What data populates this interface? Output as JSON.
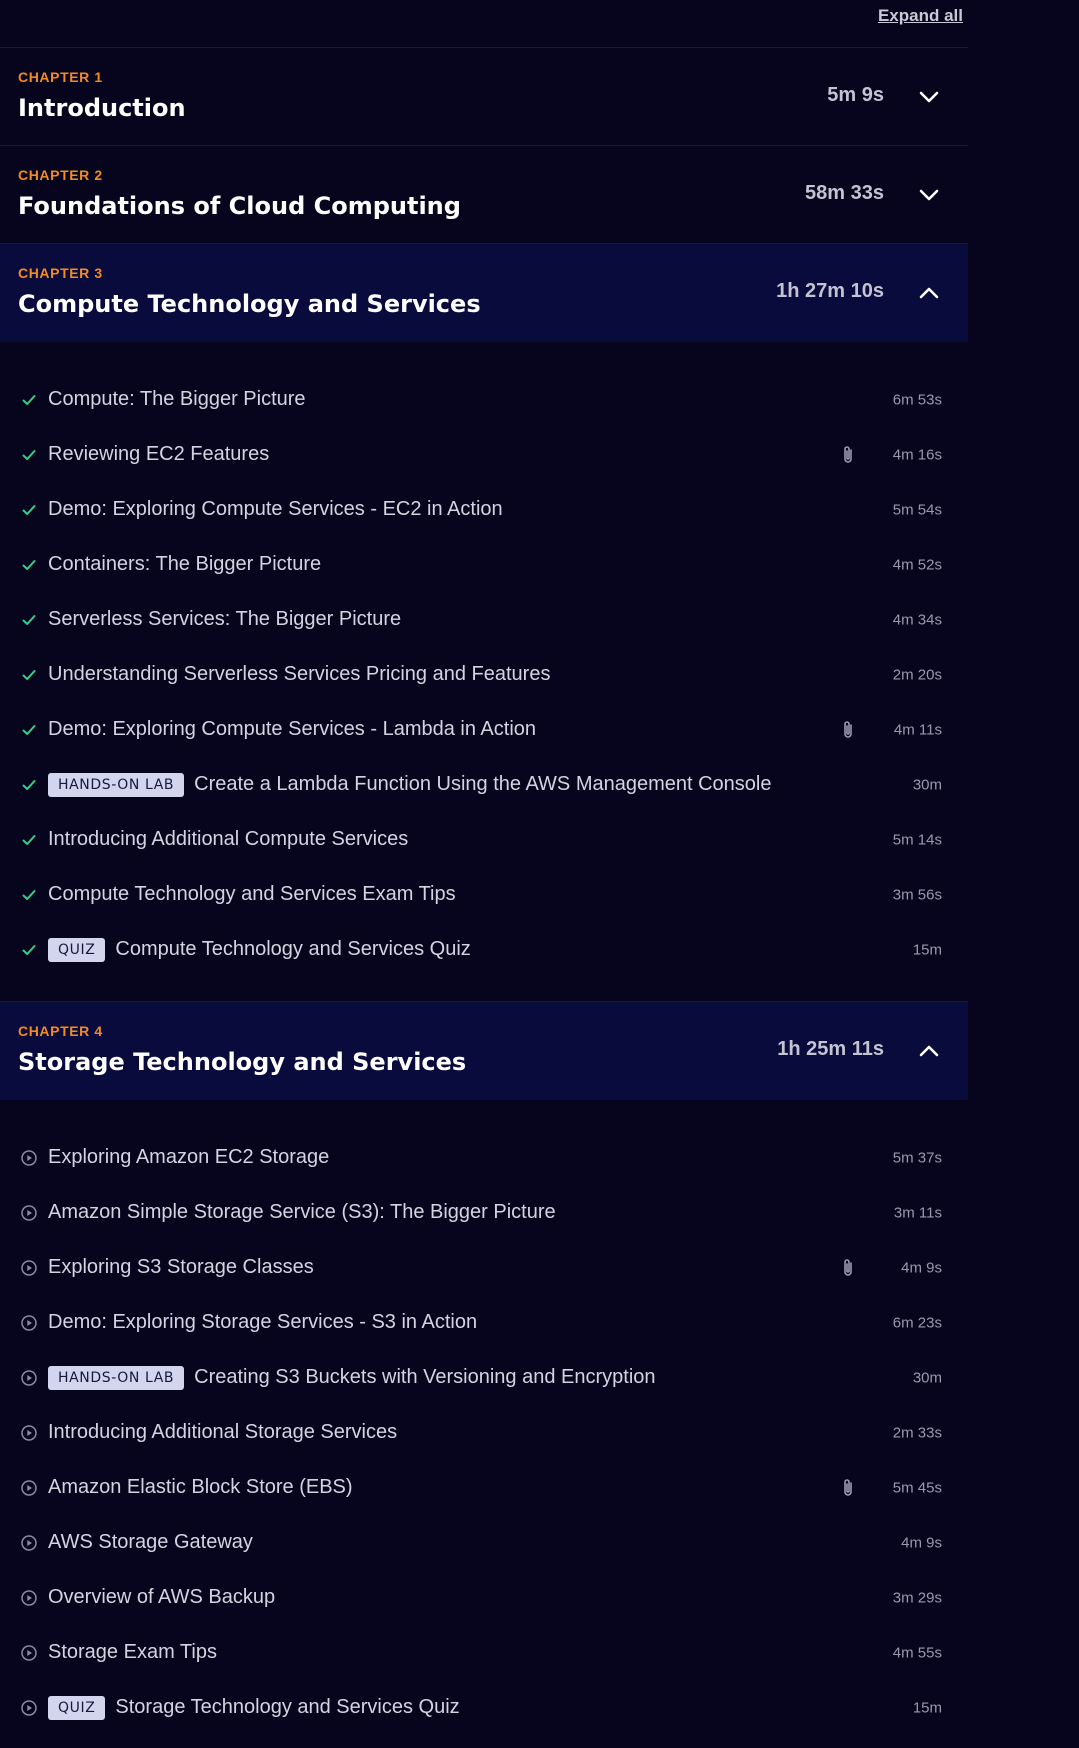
{
  "header": {
    "expand_all": "Expand all"
  },
  "chapters": [
    {
      "label": "CHAPTER 1",
      "title": "Introduction",
      "duration": "5m 9s",
      "expanded": false
    },
    {
      "label": "CHAPTER 2",
      "title": "Foundations of Cloud Computing",
      "duration": "58m 33s",
      "expanded": false
    },
    {
      "label": "CHAPTER 3",
      "title": "Compute Technology and Services",
      "duration": "1h 27m 10s",
      "expanded": true,
      "lessons": [
        {
          "title": "Compute: The Bigger Picture",
          "duration": "6m 53s",
          "status": "completed",
          "badge": "",
          "attachment": false
        },
        {
          "title": "Reviewing EC2 Features",
          "duration": "4m 16s",
          "status": "completed",
          "badge": "",
          "attachment": true
        },
        {
          "title": "Demo: Exploring Compute Services - EC2 in Action",
          "duration": "5m 54s",
          "status": "completed",
          "badge": "",
          "attachment": false
        },
        {
          "title": "Containers: The Bigger Picture",
          "duration": "4m 52s",
          "status": "completed",
          "badge": "",
          "attachment": false
        },
        {
          "title": "Serverless Services: The Bigger Picture",
          "duration": "4m 34s",
          "status": "completed",
          "badge": "",
          "attachment": false
        },
        {
          "title": "Understanding Serverless Services Pricing and Features",
          "duration": "2m 20s",
          "status": "completed",
          "badge": "",
          "attachment": false
        },
        {
          "title": "Demo: Exploring Compute Services - Lambda in Action",
          "duration": "4m 11s",
          "status": "completed",
          "badge": "",
          "attachment": true
        },
        {
          "title": "Create a Lambda Function Using the AWS Management Console",
          "duration": "30m",
          "status": "completed",
          "badge": "HANDS-ON LAB",
          "attachment": false
        },
        {
          "title": "Introducing Additional Compute Services",
          "duration": "5m 14s",
          "status": "completed",
          "badge": "",
          "attachment": false
        },
        {
          "title": "Compute Technology and Services Exam Tips",
          "duration": "3m 56s",
          "status": "completed",
          "badge": "",
          "attachment": false
        },
        {
          "title": "Compute Technology and Services Quiz",
          "duration": "15m",
          "status": "completed",
          "badge": "QUIZ",
          "attachment": false
        }
      ]
    },
    {
      "label": "CHAPTER 4",
      "title": "Storage Technology and Services",
      "duration": "1h 25m 11s",
      "expanded": true,
      "lessons": [
        {
          "title": "Exploring Amazon EC2 Storage",
          "duration": "5m 37s",
          "status": "not-started",
          "badge": "",
          "attachment": false
        },
        {
          "title": "Amazon Simple Storage Service (S3): The Bigger Picture",
          "duration": "3m 11s",
          "status": "not-started",
          "badge": "",
          "attachment": false
        },
        {
          "title": "Exploring S3 Storage Classes",
          "duration": "4m 9s",
          "status": "not-started",
          "badge": "",
          "attachment": true
        },
        {
          "title": "Demo: Exploring Storage Services - S3 in Action",
          "duration": "6m 23s",
          "status": "not-started",
          "badge": "",
          "attachment": false
        },
        {
          "title": "Creating S3 Buckets with Versioning and Encryption",
          "duration": "30m",
          "status": "not-started",
          "badge": "HANDS-ON LAB",
          "attachment": false
        },
        {
          "title": "Introducing Additional Storage Services",
          "duration": "2m 33s",
          "status": "not-started",
          "badge": "",
          "attachment": false
        },
        {
          "title": "Amazon Elastic Block Store (EBS)",
          "duration": "5m 45s",
          "status": "not-started",
          "badge": "",
          "attachment": true
        },
        {
          "title": "AWS Storage Gateway",
          "duration": "4m 9s",
          "status": "not-started",
          "badge": "",
          "attachment": false
        },
        {
          "title": "Overview of AWS Backup",
          "duration": "3m 29s",
          "status": "not-started",
          "badge": "",
          "attachment": false
        },
        {
          "title": "Storage Exam Tips",
          "duration": "4m 55s",
          "status": "not-started",
          "badge": "",
          "attachment": false
        },
        {
          "title": "Storage Technology and Services Quiz",
          "duration": "15m",
          "status": "not-started",
          "badge": "QUIZ",
          "attachment": false
        }
      ]
    }
  ],
  "icons": {
    "completed": "check-icon",
    "not-started": "play-circle-icon",
    "attachment": "paperclip-icon",
    "collapsed": "chevron-down-icon",
    "expanded": "chevron-up-icon"
  },
  "colors": {
    "background": "#07051d",
    "expanded_header": "#0a0b3d",
    "chapter_label": "#f58a1f",
    "check": "#2fd38a",
    "badge_bg": "#d3d5ef"
  }
}
